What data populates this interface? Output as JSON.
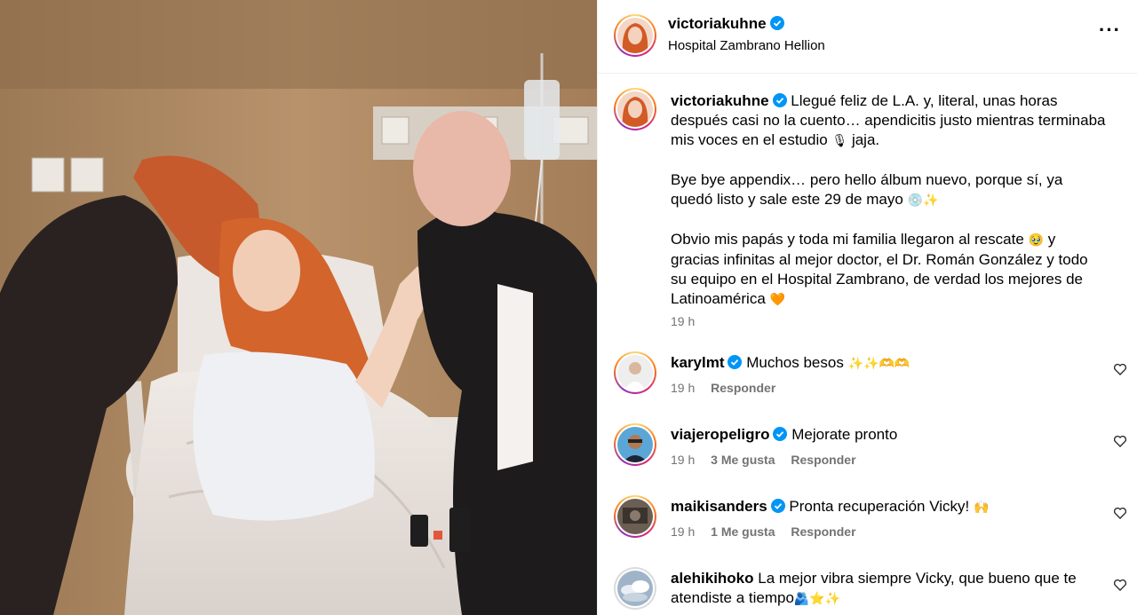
{
  "post": {
    "username": "victoriakuhne",
    "location": "Hospital Zambrano Hellion",
    "more_icon": "more-horizontal-icon",
    "caption": {
      "username": "victoriakuhne",
      "line1": "Llegué feliz de L.A. y, literal, unas horas después casi no la cuento… apendicitis justo mientras terminaba mis voces en el estudio",
      "line1_emoji": "🎙",
      "line1_tail": " jaja.",
      "line2": "Bye bye appendix… pero hello álbum nuevo, porque sí, ya quedó listo y sale este 29 de mayo",
      "line2_emoji": "💿✨",
      "line3": "Obvio mis papás y toda mi familia llegaron al rescate",
      "line3_emoji": "🥹",
      "line3_tail": " y gracias infinitas al mejor doctor, el Dr. Román González y todo su equipo en el Hospital Zambrano, de verdad los mejores de Latinoamérica",
      "line3_end_emoji": "🧡",
      "time": "19 h"
    }
  },
  "comments": [
    {
      "username": "karylmt",
      "text": "Muchos besos",
      "emoji": "✨✨🫶🫶",
      "time": "19 h",
      "likes": "",
      "reply": "Responder"
    },
    {
      "username": "viajeropeligro",
      "text": "Mejorate pronto",
      "emoji": "",
      "time": "19 h",
      "likes": "3 Me gusta",
      "reply": "Responder"
    },
    {
      "username": "maikisanders",
      "text": "Pronta recuperación Vicky!",
      "emoji": "🙌",
      "time": "19 h",
      "likes": "1 Me gusta",
      "reply": "Responder"
    },
    {
      "username": "alehikihoko",
      "text": "La mejor vibra siempre Vicky, que bueno que te atendiste a tiempo",
      "emoji": "🫂⭐✨",
      "time": "",
      "likes": "",
      "reply": ""
    }
  ],
  "colors": {
    "verified": "#0095f6",
    "secondary_text": "#737373",
    "divider": "#efefef"
  }
}
